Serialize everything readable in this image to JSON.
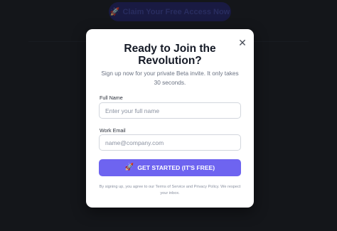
{
  "background": {
    "cta_label": "Claim Your Free Access Now",
    "cta_icon": "rocket-icon"
  },
  "modal": {
    "title": "Ready to Join the Revolution?",
    "subtitle": "Sign up now for your private Beta invite. It only takes 30 seconds.",
    "close_icon": "close-icon",
    "fields": {
      "full_name": {
        "label": "Full Name",
        "value": "",
        "placeholder": "Enter your full name"
      },
      "work_email": {
        "label": "Work Email",
        "value": "",
        "placeholder": "name@company.com"
      }
    },
    "submit": {
      "label": "GET STARTED (IT'S FREE)",
      "icon": "rocket-icon"
    },
    "fine_print": {
      "prefix": "By signing up, you agree to our ",
      "terms": "Terms of Service",
      "and": " and ",
      "privacy": "Privacy Policy",
      "suffix": ". We respect your inbox."
    }
  },
  "colors": {
    "page_bg": "#1b1d21",
    "accent": "#6e64f0",
    "title": "#151a26"
  }
}
